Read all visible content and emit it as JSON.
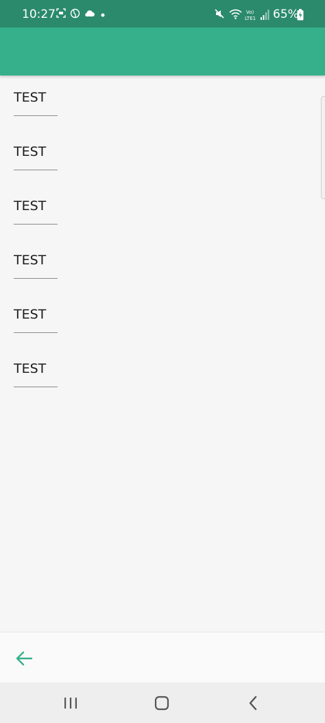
{
  "status_bar": {
    "time": "10:27",
    "battery": "65%",
    "icons": [
      "screen-record-icon",
      "vpn-globe-icon",
      "cloud-icon",
      "notification-dot-icon",
      "mute-icon",
      "wifi-icon",
      "volte-lte-icon",
      "signal-icon",
      "battery-charging-icon"
    ]
  },
  "colors": {
    "status_bar": "#2b8a6c",
    "app_bar": "#36b08a",
    "accent": "#36b08a",
    "background": "#f6f6f6"
  },
  "list": {
    "items": [
      {
        "label": "TEST"
      },
      {
        "label": "TEST"
      },
      {
        "label": "TEST"
      },
      {
        "label": "TEST"
      },
      {
        "label": "TEST"
      },
      {
        "label": "TEST"
      }
    ]
  },
  "bottom_bar": {
    "back_icon": "arrow-left-icon"
  },
  "nav_bar": {
    "buttons": [
      "recent-apps-icon",
      "home-icon",
      "back-icon"
    ]
  }
}
